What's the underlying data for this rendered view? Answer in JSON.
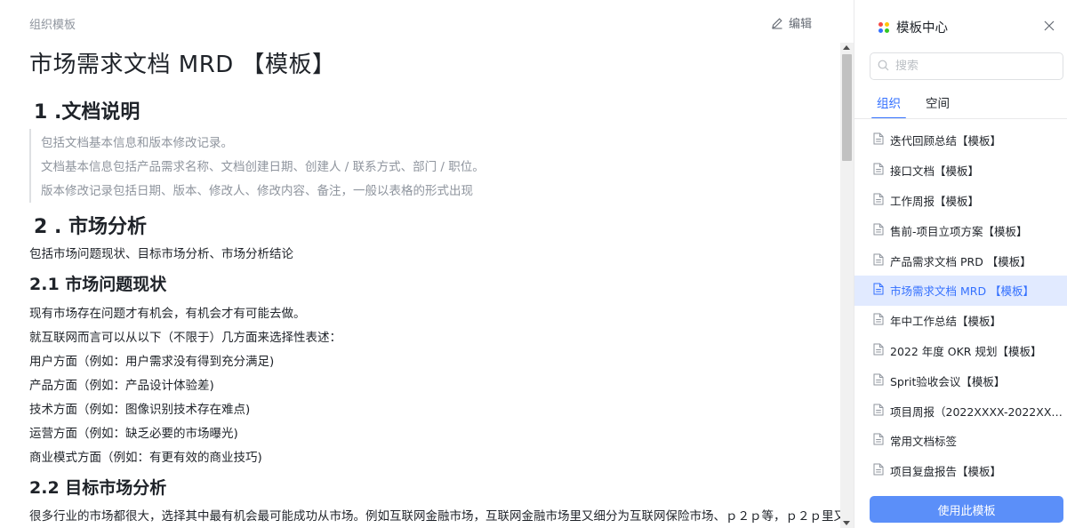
{
  "doc": {
    "breadcrumb": "组织模板",
    "edit_label": "编辑",
    "title": "市场需求文档 MRD 【模板】",
    "section1": {
      "heading": "1 .文档说明",
      "quote": [
        "包括文档基本信息和版本修改记录。",
        "文档基本信息包括产品需求名称、文档创建日期、创建人 / 联系方式、部门 / 职位。",
        "版本修改记录包括日期、版本、修改人、修改内容、备注，一般以表格的形式出现"
      ]
    },
    "section2": {
      "heading": "2 . 市场分析",
      "intro": "包括市场问题现状、目标市场分析、市场分析结论",
      "sub1": {
        "heading": "2.1 市场问题现状",
        "lines": [
          "现有市场存在问题才有机会，有机会才有可能去做。",
          "就互联网而言可以从以下（不限于）几方面来选择性表述：",
          "用户方面（例如：用户需求没有得到充分满足)",
          "产品方面（例如：产品设计体验差)",
          "技术方面（例如：图像识别技术存在难点)",
          "运营方面（例如：缺乏必要的市场曝光)",
          "商业模式方面（例如：有更有效的商业技巧)"
        ]
      },
      "sub2": {
        "heading": "2.2 目标市场分析",
        "line": "很多行业的市场都很大，选择其中最有机会最可能成功从市场。例如互联网金融市场，互联网金融市场里又细分为互联网保险市场、ｐ２ｐ等，ｐ２ｐ里又"
      }
    }
  },
  "panel": {
    "title": "模板中心",
    "search_placeholder": "搜索",
    "tabs": [
      {
        "label": "组织",
        "active": true
      },
      {
        "label": "空间",
        "active": false
      }
    ],
    "items": [
      {
        "label": "迭代回顾总结【模板】",
        "active": false
      },
      {
        "label": "接口文档【模板】",
        "active": false
      },
      {
        "label": "工作周报【模板】",
        "active": false
      },
      {
        "label": "售前-项目立项方案【模板】",
        "active": false
      },
      {
        "label": "产品需求文档 PRD 【模板】",
        "active": false
      },
      {
        "label": "市场需求文档 MRD 【模板】",
        "active": true
      },
      {
        "label": "年中工作总结【模板】",
        "active": false
      },
      {
        "label": "2022 年度 OKR 规划【模板】",
        "active": false
      },
      {
        "label": "Sprit验收会议【模板】",
        "active": false
      },
      {
        "label": "项目周报（2022XXXX-2022XXXX...",
        "active": false
      },
      {
        "label": "常用文档标签",
        "active": false
      },
      {
        "label": "项目复盘报告【模板】",
        "active": false
      }
    ],
    "use_button": "使用此模板"
  },
  "colors": {
    "accent": "#3370ff",
    "button": "#5b8ff9",
    "active_bg": "#e1eaff",
    "logo_dots": [
      "#f54a45",
      "#ffc60a",
      "#3370ff",
      "#34c724"
    ]
  }
}
